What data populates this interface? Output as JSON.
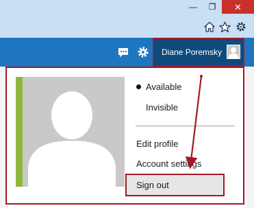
{
  "window_controls": {
    "minimize_glyph": "—",
    "maximize_glyph": "❐",
    "close_glyph": "✕"
  },
  "browser_toolbar": {
    "icons": [
      "home-icon",
      "favorites-star-icon",
      "settings-gear-icon"
    ]
  },
  "header": {
    "icons": [
      "chat-icon",
      "settings-gear-icon"
    ],
    "account_name": "Diane Poremsky"
  },
  "profile_menu": {
    "status_options": [
      {
        "label": "Available",
        "selected": true
      },
      {
        "label": "Invisible",
        "selected": false
      }
    ],
    "edit_profile_label": "Edit profile",
    "account_settings_label": "Account settings",
    "sign_out_label": "Sign out"
  },
  "colors": {
    "header_blue": "#1e76bf",
    "account_button": "#0f4a7d",
    "highlight_red": "#a31726",
    "photo_accent_green": "#8db63c",
    "close_button_red": "#c7302b"
  }
}
